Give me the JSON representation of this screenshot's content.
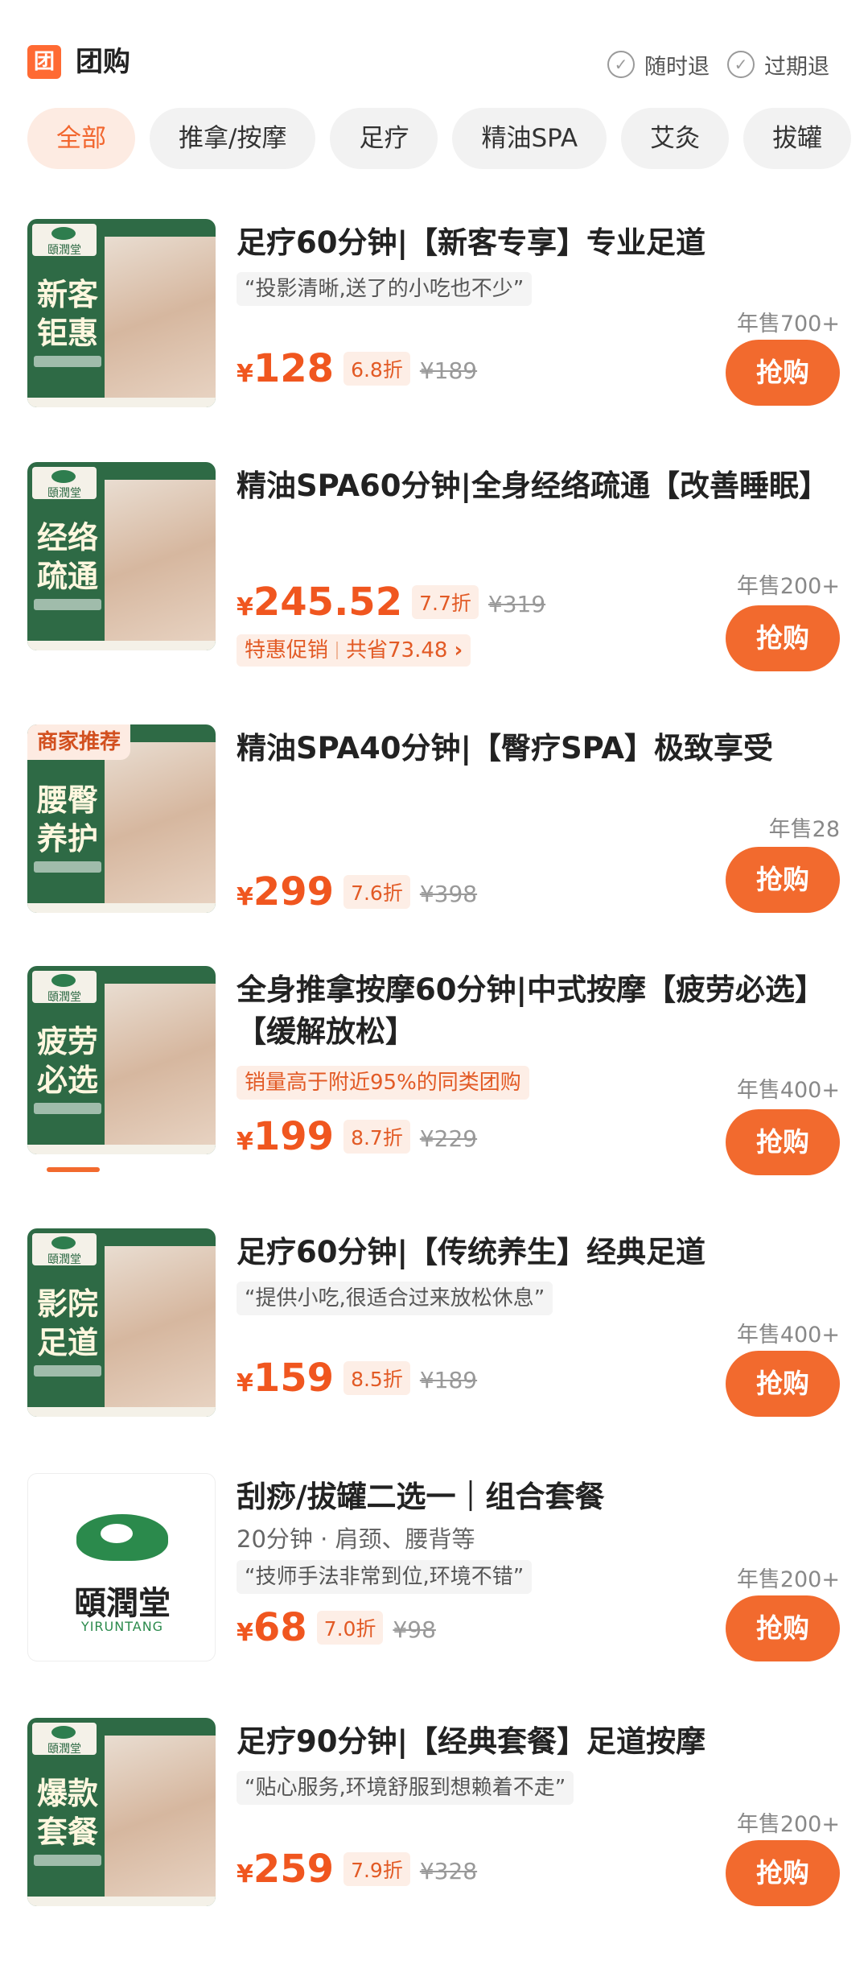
{
  "header": {
    "logo_char": "团",
    "title": "团购",
    "tags": [
      "随时退",
      "过期退"
    ]
  },
  "filters": [
    "全部",
    "推拿/按摩",
    "足疗",
    "精油SPA",
    "艾灸",
    "拔罐"
  ],
  "colors": {
    "accent": "#f26a2e",
    "price": "#f0561f",
    "chip_active_bg": "#fdebe2",
    "thumb_green": "#2e6a45"
  },
  "products": [
    {
      "thumb_text": "新客钜惠",
      "title": "足疗60分钟|【新客专享】专业足道",
      "quote": "“投影清晰,送了的小吃也不少”",
      "sold": "年售700+",
      "yen": "¥",
      "price": "128",
      "discount": "6.8折",
      "original": "¥189",
      "button": "抢购"
    },
    {
      "thumb_text": "经络疏通",
      "title": "精油SPA60分钟|全身经络疏通【改善睡眠】",
      "promo_label": "特惠促销",
      "promo_save": "共省73.48",
      "promo_arrow": "›",
      "sold": "年售200+",
      "yen": "¥",
      "price": "245.52",
      "discount": "7.7折",
      "original": "¥319",
      "button": "抢购"
    },
    {
      "badge": "商家推荐",
      "thumb_text": "腰臀养护",
      "title": "精油SPA40分钟|【臀疗SPA】极致享受",
      "sold": "年售28",
      "yen": "¥",
      "price": "299",
      "discount": "7.6折",
      "original": "¥398",
      "button": "抢购"
    },
    {
      "thumb_text": "疲劳必选",
      "title": "全身推拿按摩60分钟|中式按摩【疲劳必选】【缓解放松】",
      "hot": "销量高于附近95%的同类团购",
      "sold": "年售400+",
      "yen": "¥",
      "price": "199",
      "discount": "8.7折",
      "original": "¥229",
      "button": "抢购"
    },
    {
      "thumb_text": "影院足道",
      "title": "足疗60分钟|【传统养生】经典足道",
      "quote": "“提供小吃,很适合过来放松休息”",
      "sold": "年售400+",
      "yen": "¥",
      "price": "159",
      "discount": "8.5折",
      "original": "¥189",
      "button": "抢购"
    },
    {
      "logo_name": "頤潤堂",
      "logo_latin": "YIRUNTANG",
      "title": "刮痧/拔罐二选一｜组合套餐",
      "meta": "20分钟 · 肩颈、腰背等",
      "quote": "“技师手法非常到位,环境不错”",
      "sold": "年售200+",
      "yen": "¥",
      "price": "68",
      "discount": "7.0折",
      "original": "¥98",
      "button": "抢购"
    },
    {
      "thumb_text": "爆款套餐",
      "title": "足疗90分钟|【经典套餐】足道按摩",
      "quote": "“贴心服务,环境舒服到想赖着不走”",
      "sold": "年售200+",
      "yen": "¥",
      "price": "259",
      "discount": "7.9折",
      "original": "¥328",
      "button": "抢购"
    }
  ]
}
